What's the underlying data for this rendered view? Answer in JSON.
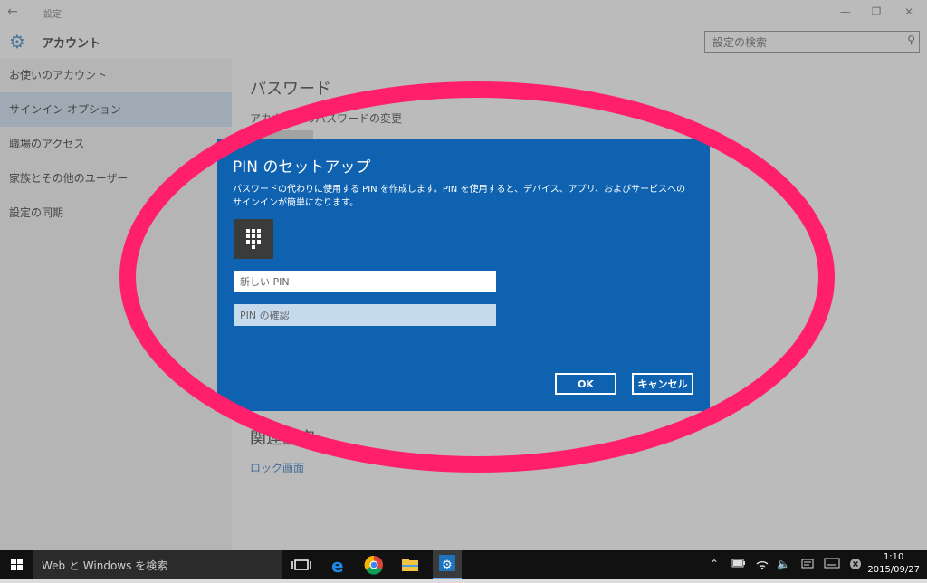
{
  "window": {
    "title": "設定",
    "back_glyph": "←",
    "minimize_glyph": "—",
    "restore_glyph": "❐",
    "close_glyph": "✕"
  },
  "header": {
    "app_name": "アカウント",
    "icon": "gear-icon",
    "search_placeholder": "設定の検索"
  },
  "sidebar": {
    "items": [
      {
        "label": "お使いのアカウント"
      },
      {
        "label": "サインイン オプション",
        "active": true
      },
      {
        "label": "職場のアクセス"
      },
      {
        "label": "家族とその他のユーザー"
      },
      {
        "label": "設定の同期"
      }
    ]
  },
  "content": {
    "password_title": "パスワード",
    "password_sub": "アカウントのパスワードの変更",
    "related_title": "関連設定",
    "related_link": "ロック画面"
  },
  "dialog": {
    "title": "PIN のセットアップ",
    "description": "パスワードの代わりに使用する PIN を作成します。PIN を使用すると、デバイス、アプリ、およびサービスへのサインインが簡単になります。",
    "icon": "keypad-icon",
    "new_pin_placeholder": "新しい PIN",
    "confirm_pin_placeholder": "PIN の確認",
    "ok_label": "OK",
    "cancel_label": "キャンセル"
  },
  "annotation": {
    "color": "#ff1f6b"
  },
  "taskbar": {
    "search_placeholder": "Web と Windows を検索",
    "apps": [
      "task-view-icon",
      "edge-icon",
      "chrome-icon",
      "file-explorer-icon",
      "settings-icon"
    ],
    "tray": [
      "chevron-up-icon",
      "battery-icon",
      "wifi-icon",
      "volume-mute-icon",
      "action-center-icon",
      "keyboard-icon",
      "close-circle-icon"
    ],
    "time": "1:10",
    "date": "2015/09/27"
  }
}
